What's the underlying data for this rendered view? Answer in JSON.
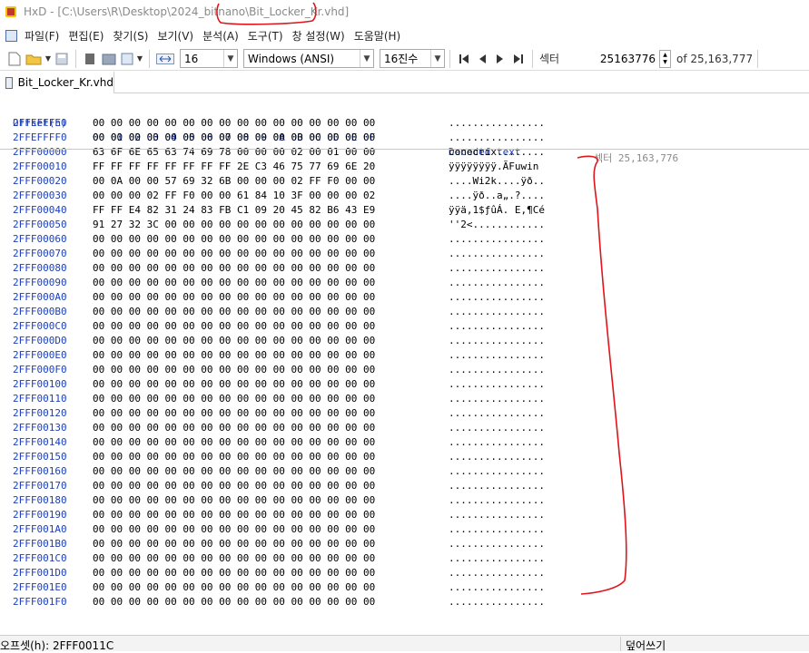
{
  "window": {
    "title": "HxD - [C:\\Users\\R\\Desktop\\2024_bitnano\\Bit_Locker_Kr.vhd]"
  },
  "menu": [
    "파일(F)",
    "편집(E)",
    "찾기(S)",
    "보기(V)",
    "분석(A)",
    "도구(T)",
    "창 설정(W)",
    "도움말(H)"
  ],
  "toolbar": {
    "bytes_per_row": "16",
    "charset": "Windows (ANSI)",
    "radix": "16진수",
    "sector_label": "섹터",
    "sector_value": "25163776",
    "sector_total": "of 25,163,777",
    "nav_icons": [
      "first-icon",
      "prev-icon",
      "next-icon",
      "last-icon"
    ]
  },
  "tab": {
    "label": "Bit_Locker_Kr.vhd"
  },
  "hex_view": {
    "header": {
      "offset": "Offset(h)",
      "bytes": "00 01 02 03 04 05 06 07 08 09 0A 0B 0C 0D 0E 0F",
      "decoded": "Decoded text"
    },
    "sector_annotation": "섹터 25,163,776",
    "rows": [
      {
        "offset": "2FFEFFFE0",
        "bytes": "00 00 00 00 00 00 00 00 00 00 00 00 00 00 00 00",
        "decoded": "................"
      },
      {
        "offset": "2FFEFFFF0",
        "bytes": "00 00 00 00 00 00 00 00 00 00 00 00 00 00 00 00",
        "decoded": "................"
      },
      {
        "offset": "2FFF00000",
        "bytes": "63 6F 6E 65 63 74 69 78 00 00 00 02 00 01 00 00",
        "decoded": "conectix........"
      },
      {
        "offset": "2FFF00010",
        "bytes": "FF FF FF FF FF FF FF FF 2E C3 46 75 77 69 6E 20",
        "decoded": "ÿÿÿÿÿÿÿÿ.ÃFuwin "
      },
      {
        "offset": "2FFF00020",
        "bytes": "00 0A 00 00 57 69 32 6B 00 00 00 02 FF F0 00 00",
        "decoded": "....Wi2k....ÿð.."
      },
      {
        "offset": "2FFF00030",
        "bytes": "00 00 00 02 FF F0 00 00 61 84 10 3F 00 00 00 02",
        "decoded": "....ÿð..a„.?...."
      },
      {
        "offset": "2FFF00040",
        "bytes": "FF FF E4 82 31 24 83 FB C1 09 20 45 82 B6 43 E9",
        "decoded": "ÿÿä‚1$ƒûÁ. E‚¶Cé"
      },
      {
        "offset": "2FFF00050",
        "bytes": "91 27 32 3C 00 00 00 00 00 00 00 00 00 00 00 00",
        "decoded": "''2<............"
      },
      {
        "offset": "2FFF00060",
        "bytes": "00 00 00 00 00 00 00 00 00 00 00 00 00 00 00 00",
        "decoded": "................"
      },
      {
        "offset": "2FFF00070",
        "bytes": "00 00 00 00 00 00 00 00 00 00 00 00 00 00 00 00",
        "decoded": "................"
      },
      {
        "offset": "2FFF00080",
        "bytes": "00 00 00 00 00 00 00 00 00 00 00 00 00 00 00 00",
        "decoded": "................"
      },
      {
        "offset": "2FFF00090",
        "bytes": "00 00 00 00 00 00 00 00 00 00 00 00 00 00 00 00",
        "decoded": "................"
      },
      {
        "offset": "2FFF000A0",
        "bytes": "00 00 00 00 00 00 00 00 00 00 00 00 00 00 00 00",
        "decoded": "................"
      },
      {
        "offset": "2FFF000B0",
        "bytes": "00 00 00 00 00 00 00 00 00 00 00 00 00 00 00 00",
        "decoded": "................"
      },
      {
        "offset": "2FFF000C0",
        "bytes": "00 00 00 00 00 00 00 00 00 00 00 00 00 00 00 00",
        "decoded": "................"
      },
      {
        "offset": "2FFF000D0",
        "bytes": "00 00 00 00 00 00 00 00 00 00 00 00 00 00 00 00",
        "decoded": "................"
      },
      {
        "offset": "2FFF000E0",
        "bytes": "00 00 00 00 00 00 00 00 00 00 00 00 00 00 00 00",
        "decoded": "................"
      },
      {
        "offset": "2FFF000F0",
        "bytes": "00 00 00 00 00 00 00 00 00 00 00 00 00 00 00 00",
        "decoded": "................"
      },
      {
        "offset": "2FFF00100",
        "bytes": "00 00 00 00 00 00 00 00 00 00 00 00 00 00 00 00",
        "decoded": "................"
      },
      {
        "offset": "2FFF00110",
        "bytes": "00 00 00 00 00 00 00 00 00 00 00 00 00 00 00 00",
        "decoded": "................"
      },
      {
        "offset": "2FFF00120",
        "bytes": "00 00 00 00 00 00 00 00 00 00 00 00 00 00 00 00",
        "decoded": "................"
      },
      {
        "offset": "2FFF00130",
        "bytes": "00 00 00 00 00 00 00 00 00 00 00 00 00 00 00 00",
        "decoded": "................"
      },
      {
        "offset": "2FFF00140",
        "bytes": "00 00 00 00 00 00 00 00 00 00 00 00 00 00 00 00",
        "decoded": "................"
      },
      {
        "offset": "2FFF00150",
        "bytes": "00 00 00 00 00 00 00 00 00 00 00 00 00 00 00 00",
        "decoded": "................"
      },
      {
        "offset": "2FFF00160",
        "bytes": "00 00 00 00 00 00 00 00 00 00 00 00 00 00 00 00",
        "decoded": "................"
      },
      {
        "offset": "2FFF00170",
        "bytes": "00 00 00 00 00 00 00 00 00 00 00 00 00 00 00 00",
        "decoded": "................"
      },
      {
        "offset": "2FFF00180",
        "bytes": "00 00 00 00 00 00 00 00 00 00 00 00 00 00 00 00",
        "decoded": "................"
      },
      {
        "offset": "2FFF00190",
        "bytes": "00 00 00 00 00 00 00 00 00 00 00 00 00 00 00 00",
        "decoded": "................"
      },
      {
        "offset": "2FFF001A0",
        "bytes": "00 00 00 00 00 00 00 00 00 00 00 00 00 00 00 00",
        "decoded": "................"
      },
      {
        "offset": "2FFF001B0",
        "bytes": "00 00 00 00 00 00 00 00 00 00 00 00 00 00 00 00",
        "decoded": "................"
      },
      {
        "offset": "2FFF001C0",
        "bytes": "00 00 00 00 00 00 00 00 00 00 00 00 00 00 00 00",
        "decoded": "................"
      },
      {
        "offset": "2FFF001D0",
        "bytes": "00 00 00 00 00 00 00 00 00 00 00 00 00 00 00 00",
        "decoded": "................"
      },
      {
        "offset": "2FFF001E0",
        "bytes": "00 00 00 00 00 00 00 00 00 00 00 00 00 00 00 00",
        "decoded": "................"
      },
      {
        "offset": "2FFF001F0",
        "bytes": "00 00 00 00 00 00 00 00 00 00 00 00 00 00 00 00",
        "decoded": "................"
      }
    ]
  },
  "status": {
    "offset": "오프셋(h): 2FFF0011C",
    "mode": "덮어쓰기"
  },
  "colors": {
    "offset_blue": "#1c3fb8",
    "annotation_red": "#e0141b",
    "sector_gray": "#8a8a8a"
  }
}
